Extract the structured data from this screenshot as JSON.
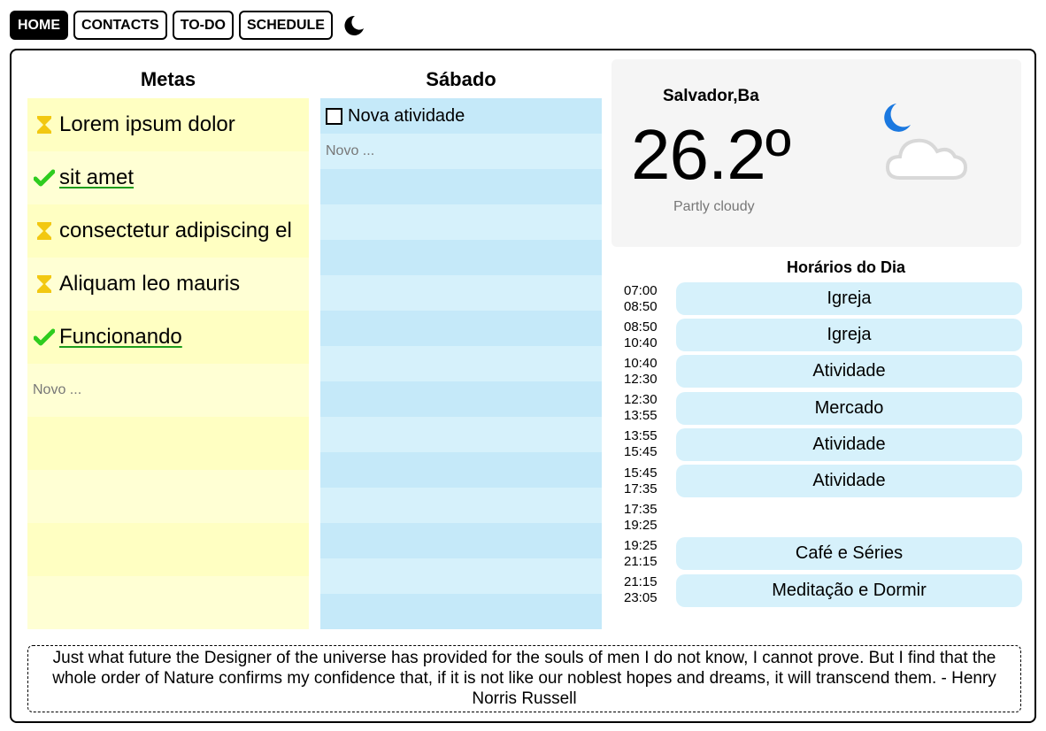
{
  "nav": {
    "items": [
      "HOME",
      "CONTACTS",
      "TO-DO",
      "SCHEDULE"
    ],
    "active": "HOME",
    "theme_icon": "moon-icon"
  },
  "goals": {
    "title": "Metas",
    "items": [
      {
        "text": "Lorem ipsum dolor",
        "status": "pending",
        "icon": "hourglass-icon"
      },
      {
        "text": "sit amet",
        "status": "done",
        "icon": "check-icon"
      },
      {
        "text": "consectetur adipiscing el",
        "status": "pending",
        "icon": "hourglass-icon"
      },
      {
        "text": "Aliquam leo mauris",
        "status": "pending",
        "icon": "hourglass-icon"
      },
      {
        "text": "Funcionando",
        "status": "done",
        "icon": "check-icon"
      }
    ],
    "new_placeholder": "Novo ..."
  },
  "day": {
    "title": "Sábado",
    "items": [
      {
        "text": "Nova atividade",
        "checked": false
      }
    ],
    "new_placeholder": "Novo ..."
  },
  "weather": {
    "city": "Salvador,Ba",
    "temperature": "26.2º",
    "description": "Partly cloudy",
    "icon": "partly-cloudy-night-icon"
  },
  "schedule": {
    "title": "Horários do Dia",
    "slots": [
      {
        "start": "07:00",
        "end": "08:50",
        "activity": "Igreja"
      },
      {
        "start": "08:50",
        "end": "10:40",
        "activity": "Igreja"
      },
      {
        "start": "10:40",
        "end": "12:30",
        "activity": "Atividade"
      },
      {
        "start": "12:30",
        "end": "13:55",
        "activity": "Mercado"
      },
      {
        "start": "13:55",
        "end": "15:45",
        "activity": "Atividade"
      },
      {
        "start": "15:45",
        "end": "17:35",
        "activity": "Atividade"
      },
      {
        "start": "17:35",
        "end": "19:25",
        "activity": ""
      },
      {
        "start": "19:25",
        "end": "21:15",
        "activity": "Café e Séries"
      },
      {
        "start": "21:15",
        "end": "23:05",
        "activity": "Meditação e Dormir"
      }
    ]
  },
  "quote": {
    "text": "Just what future the Designer of the universe has provided for the souls of men I do not know, I cannot prove. But I find that the whole order of Nature confirms my confidence that, if it is not like our noblest hopes and dreams, it will transcend them. - Henry Norris Russell"
  },
  "colors": {
    "goal_row_a": "#ffffc2",
    "goal_row_b": "#ffffd4",
    "day_row_a": "#c5e9f9",
    "day_row_b": "#d6f1fb",
    "hourglass": "#f2c811",
    "check": "#2ecc1f",
    "moon_blue": "#1a78e0"
  }
}
